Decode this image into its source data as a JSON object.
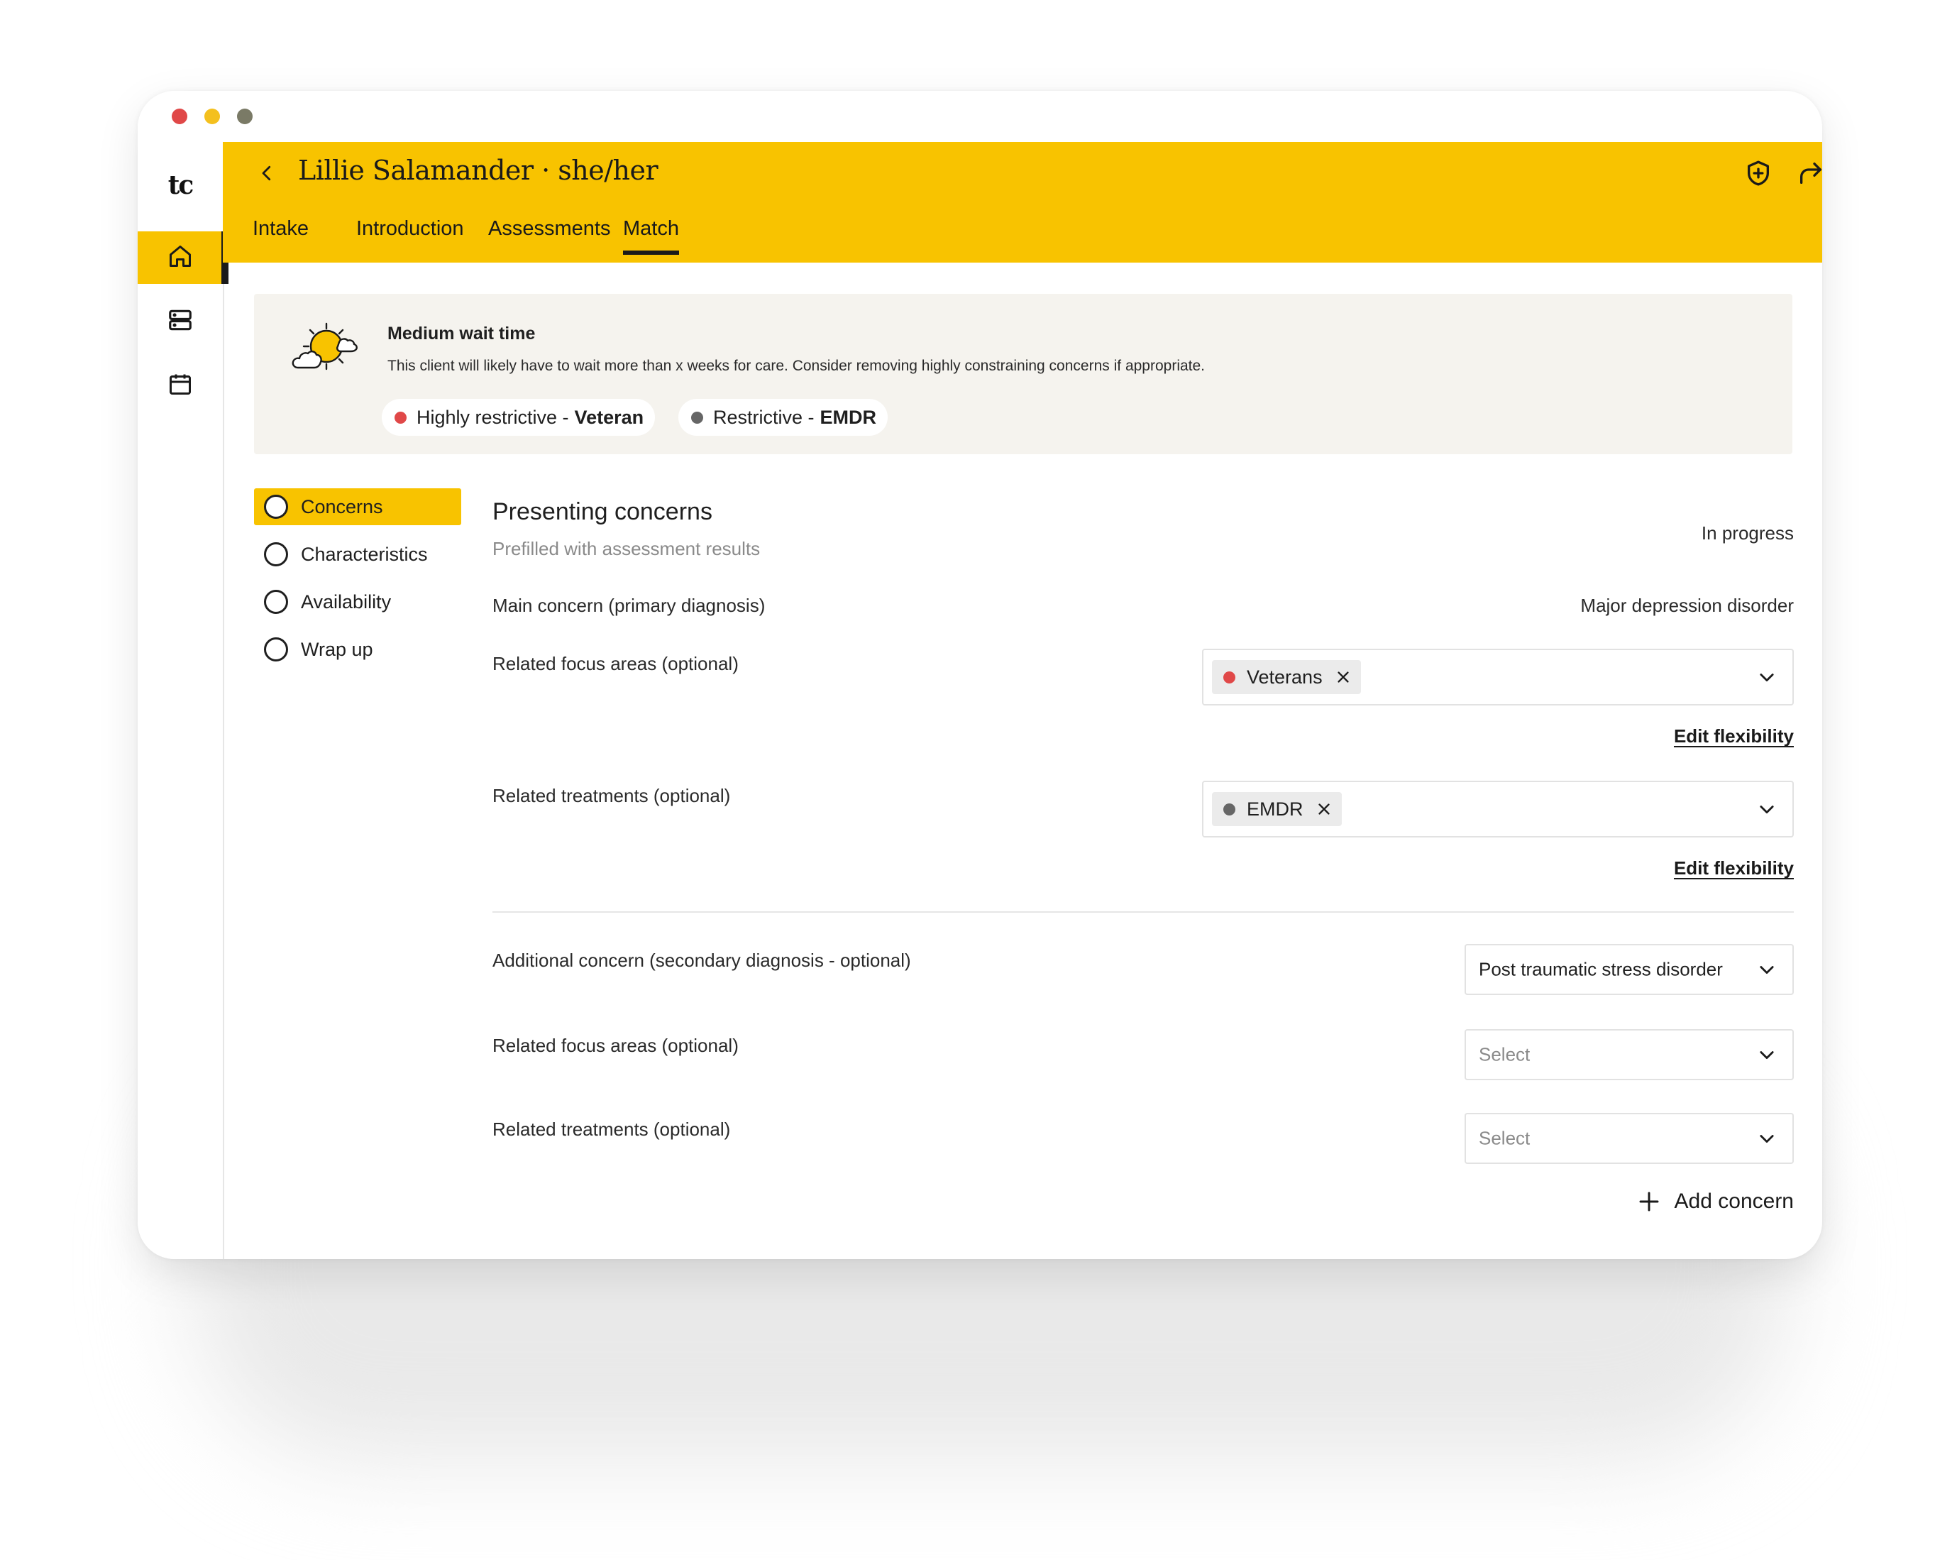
{
  "app": {
    "logo": "tc",
    "sidebar": [
      {
        "icon": "home-icon",
        "active": true
      },
      {
        "icon": "server-icon",
        "active": false
      },
      {
        "icon": "calendar-icon",
        "active": false
      }
    ]
  },
  "header": {
    "client_name": "Lillie Salamander · she/her",
    "icons": [
      "shield-plus-icon",
      "share-icon",
      "more-vertical-icon"
    ],
    "tabs": [
      {
        "label": "Intake"
      },
      {
        "label": "Introduction"
      },
      {
        "label": "Assessments"
      },
      {
        "label": "Match",
        "active": true
      }
    ]
  },
  "banner": {
    "icon": "sun-cloud-icon",
    "title": "Medium wait time",
    "text": "This client will likely have to wait more than x weeks for care. Consider removing highly constraining concerns if appropriate.",
    "pills": [
      {
        "prefix": "Highly restrictive -",
        "value": "Veteran",
        "color": "#e04848"
      },
      {
        "prefix": "Restrictive -",
        "value": "EMDR",
        "color": "#666666"
      }
    ]
  },
  "steps": [
    {
      "label": "Concerns",
      "active": true
    },
    {
      "label": "Characteristics"
    },
    {
      "label": "Availability"
    },
    {
      "label": "Wrap up"
    }
  ],
  "form": {
    "title": "Presenting concerns",
    "subtitle": "Prefilled with assessment results",
    "status": "In progress",
    "main_concern_label": "Main concern (primary diagnosis)",
    "main_concern_value": "Major depression disorder",
    "focus_label": "Related focus areas (optional)",
    "focus_chip": {
      "label": "Veterans",
      "color": "#e04848"
    },
    "treatments_label": "Related treatments (optional)",
    "treatments_chip": {
      "label": "EMDR",
      "color": "#666666"
    },
    "edit_flexibility": "Edit flexibility",
    "additional_label": "Additional concern (secondary diagnosis - optional)",
    "additional_value": "Post traumatic stress disorder",
    "focus2_label": "Related focus areas (optional)",
    "focus2_placeholder": "Select",
    "treatments2_label": "Related treatments (optional)",
    "treatments2_placeholder": "Select",
    "add_concern": "Add concern"
  },
  "colors": {
    "accent": "#f8c300",
    "red_dot": "#e04848",
    "grey_dot": "#666666",
    "banner_bg": "#f5f3ee",
    "traffic_red": "#e04848",
    "traffic_yellow": "#f4c01e",
    "traffic_grey": "#7a7a66"
  }
}
